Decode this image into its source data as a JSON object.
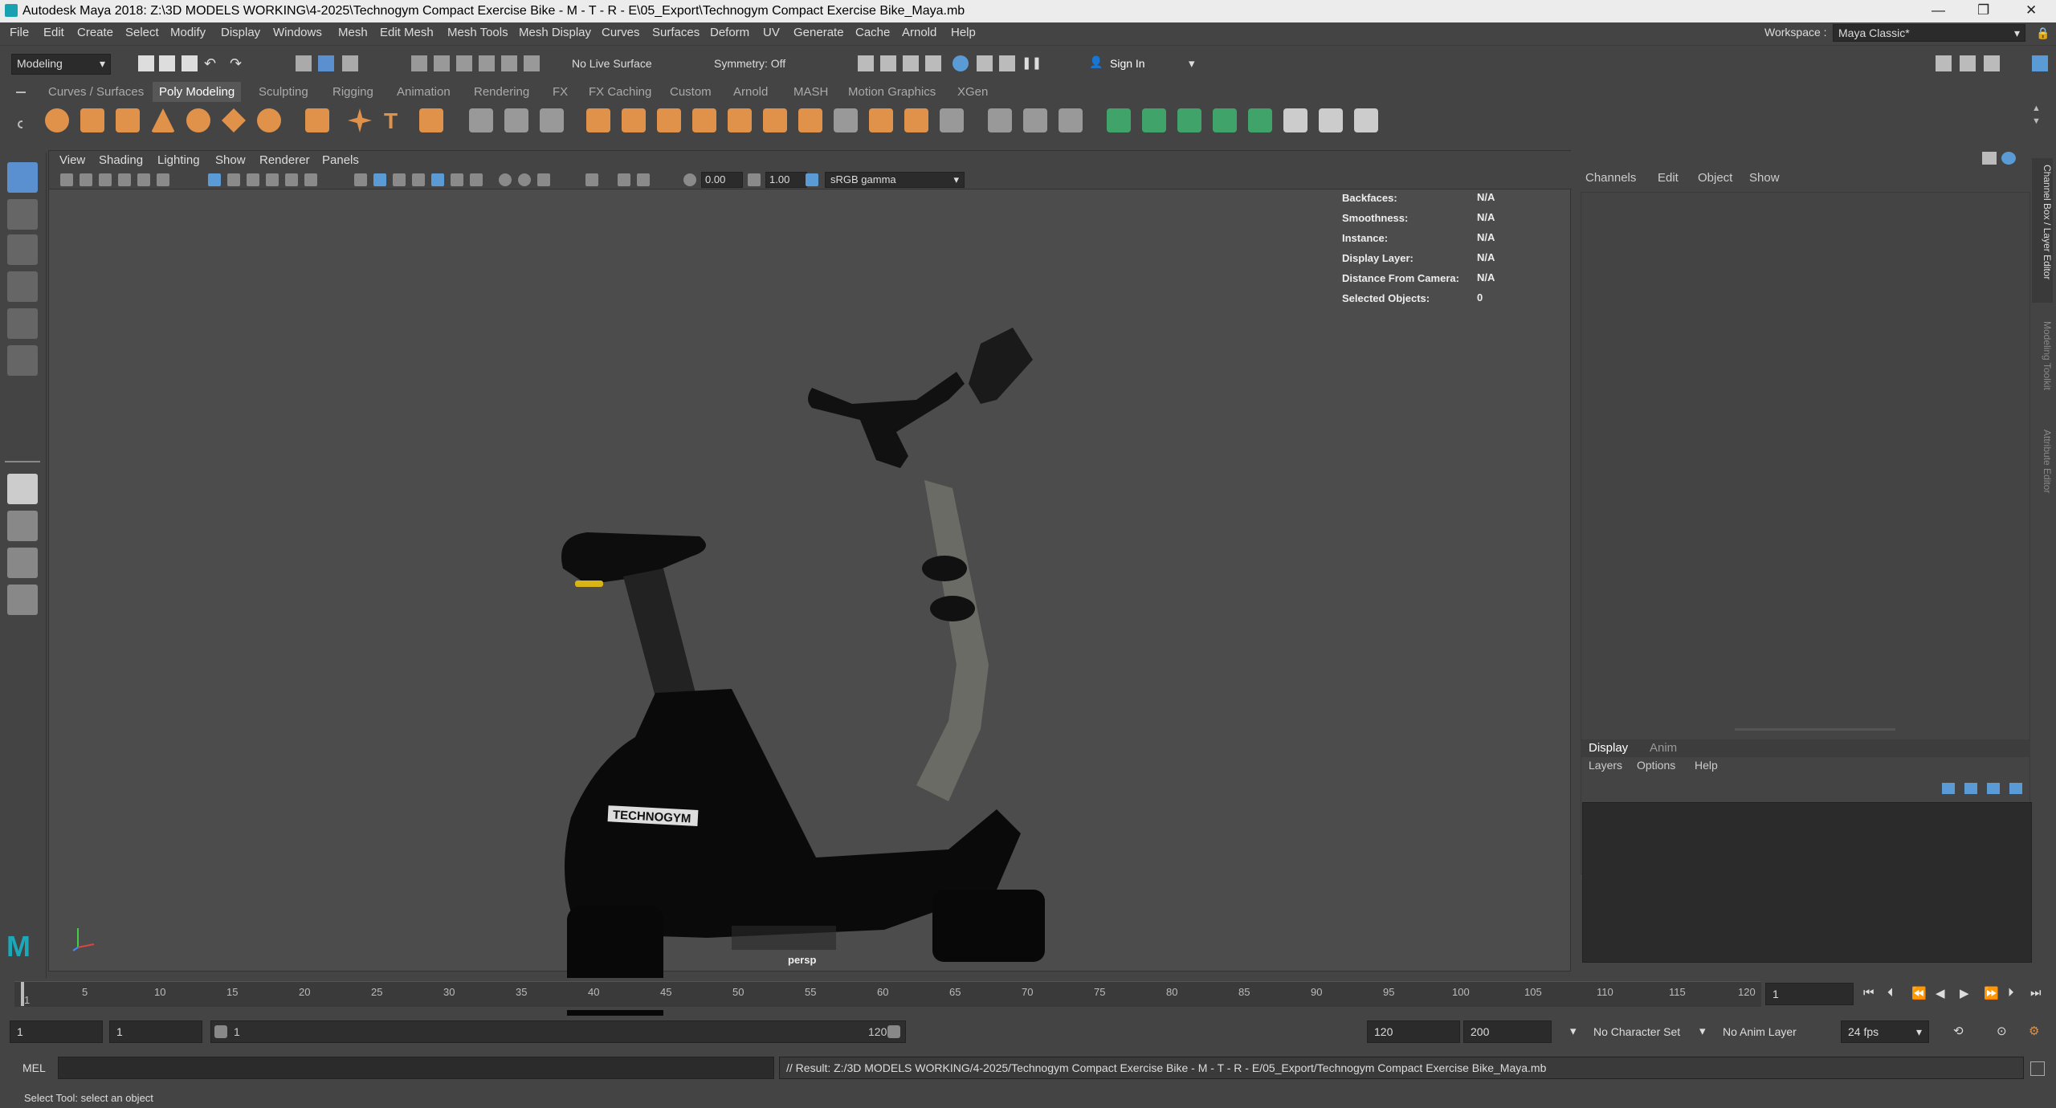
{
  "title": "Autodesk Maya 2018: Z:\\3D MODELS WORKING\\4-2025\\Technogym Compact Exercise Bike - M - T - R - E\\05_Export\\Technogym Compact Exercise Bike_Maya.mb",
  "menu": [
    "File",
    "Edit",
    "Create",
    "Select",
    "Modify",
    "Display",
    "Windows",
    "Mesh",
    "Edit Mesh",
    "Mesh Tools",
    "Mesh Display",
    "Curves",
    "Surfaces",
    "Deform",
    "UV",
    "Generate",
    "Cache",
    "Arnold",
    "Help"
  ],
  "workspace_label": "Workspace :",
  "workspace_value": "Maya Classic*",
  "status": {
    "mode": "Modeling",
    "live_surface": "No Live Surface",
    "symmetry": "Symmetry: Off",
    "sign_in": "Sign In"
  },
  "shelf_tabs": [
    "Curves / Surfaces",
    "Poly Modeling",
    "Sculpting",
    "Rigging",
    "Animation",
    "Rendering",
    "FX",
    "FX Caching",
    "Custom",
    "Arnold",
    "MASH",
    "Motion Graphics",
    "XGen"
  ],
  "viewport": {
    "menu": [
      "View",
      "Shading",
      "Lighting",
      "Show",
      "Renderer",
      "Panels"
    ],
    "exposure": "0.00",
    "gamma": "1.00",
    "colorspace": "sRGB gamma",
    "camera": "persp",
    "logo": "TECHNOGYM"
  },
  "hud": [
    {
      "k": "Backfaces:",
      "v": "N/A"
    },
    {
      "k": "Smoothness:",
      "v": "N/A"
    },
    {
      "k": "Instance:",
      "v": "N/A"
    },
    {
      "k": "Display Layer:",
      "v": "N/A"
    },
    {
      "k": "Distance From Camera:",
      "v": "N/A"
    },
    {
      "k": "Selected Objects:",
      "v": "0"
    }
  ],
  "channel_box": {
    "menu": [
      "Channels",
      "Edit",
      "Object",
      "Show"
    ],
    "side_tabs": [
      "Channel Box / Layer Editor",
      "Modeling Toolkit",
      "Attribute Editor"
    ]
  },
  "layer_editor": {
    "tabs": [
      "Display",
      "Anim"
    ],
    "menu": [
      "Layers",
      "Options",
      "Help"
    ]
  },
  "timeline": {
    "ticks": [
      "1",
      "5",
      "10",
      "15",
      "20",
      "25",
      "30",
      "35",
      "40",
      "45",
      "50",
      "55",
      "60",
      "65",
      "70",
      "75",
      "80",
      "85",
      "90",
      "95",
      "100",
      "105",
      "110",
      "115",
      "120"
    ],
    "current": "1"
  },
  "range": {
    "start": "1",
    "inner_start": "1",
    "slider_start": "1",
    "slider_end": "120",
    "inner_end": "120",
    "end": "200",
    "character_set": "No Character Set",
    "anim_layer": "No Anim Layer",
    "fps": "24 fps"
  },
  "cmd": {
    "lang": "MEL",
    "result": "// Result: Z:/3D MODELS WORKING/4-2025/Technogym Compact Exercise Bike - M - T - R - E/05_Export/Technogym Compact Exercise Bike_Maya.mb"
  },
  "help": "Select Tool: select an object"
}
